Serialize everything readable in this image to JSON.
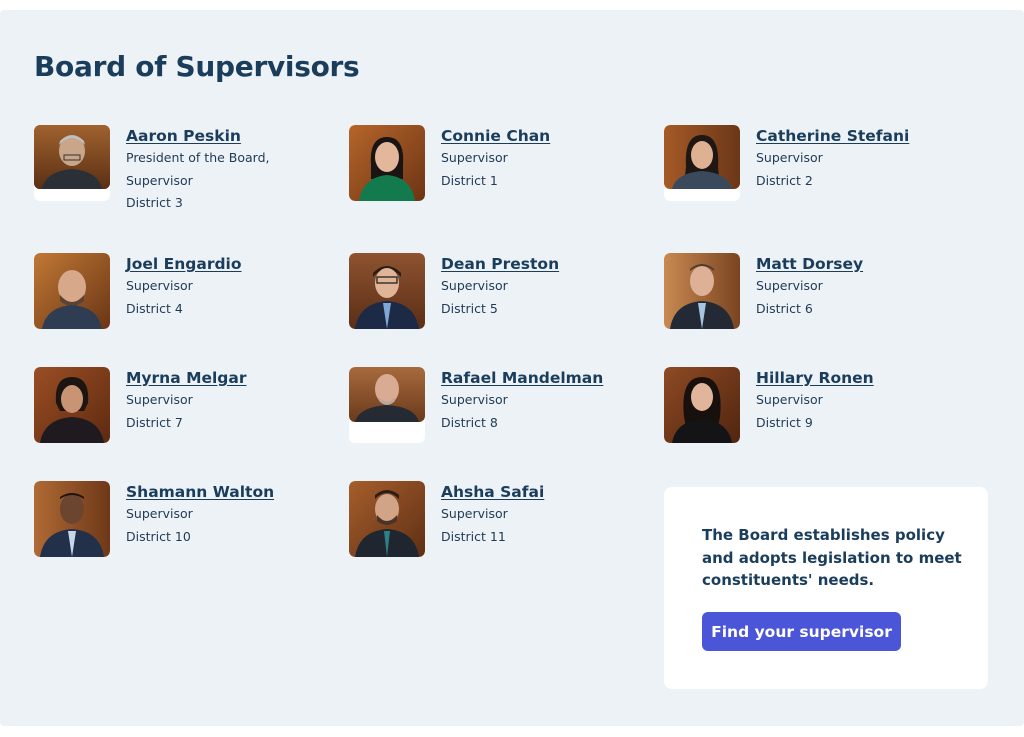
{
  "title": "Board of Supervisors",
  "supervisors": [
    {
      "name": "Aaron Peskin",
      "role": "President of the Board,",
      "role2": "Supervisor",
      "district": "District 3"
    },
    {
      "name": "Connie Chan",
      "role": "Supervisor",
      "district": "District 1"
    },
    {
      "name": "Catherine Stefani",
      "role": "Supervisor",
      "district": "District 2"
    },
    {
      "name": "Joel Engardio",
      "role": "Supervisor",
      "district": "District 4"
    },
    {
      "name": "Dean Preston",
      "role": "Supervisor",
      "district": "District 5"
    },
    {
      "name": "Matt Dorsey",
      "role": "Supervisor",
      "district": "District 6"
    },
    {
      "name": "Myrna Melgar",
      "role": "Supervisor",
      "district": "District 7"
    },
    {
      "name": "Rafael Mandelman",
      "role": "Supervisor",
      "district": "District 8"
    },
    {
      "name": "Hillary Ronen",
      "role": "Supervisor",
      "district": "District 9"
    },
    {
      "name": "Shamann Walton",
      "role": "Supervisor",
      "district": "District 10"
    },
    {
      "name": "Ahsha Safai",
      "role": "Supervisor",
      "district": "District 11"
    }
  ],
  "cta": {
    "text": "The Board establishes policy and adopts legislation to meet constituents' needs.",
    "button_label": "Find your supervisor"
  },
  "colors": {
    "panel_bg": "#edf2f7",
    "heading": "#1b3d5c",
    "button_bg": "#4b55d8",
    "photo_backdrop": "#8a4a22"
  }
}
